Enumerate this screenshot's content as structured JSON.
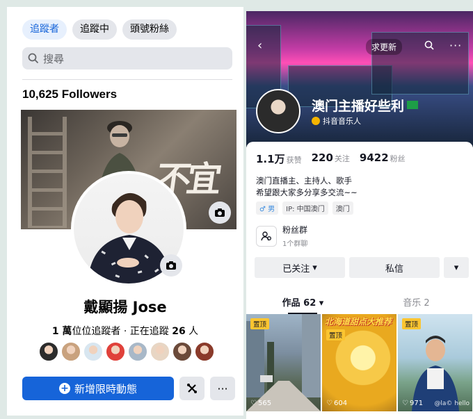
{
  "left_panel": {
    "chips": [
      "追蹤者",
      "追蹤中",
      "頭號粉絲"
    ],
    "search_placeholder": "搜尋",
    "followers_title": "10,625 Followers",
    "cover_text": "不宜遲",
    "profile_name": "戴顯揚 Jose",
    "stats": {
      "followers_count": "1 萬",
      "followers_label": "位位追蹤者",
      "separator": " · 正在追蹤 ",
      "following_count": "26",
      "following_unit": " 人"
    },
    "friend_colors": [
      "#2c2c2c",
      "#c9a27e",
      "#d8e6f0",
      "#e0413a",
      "#a8b8c8",
      "#e8d6c4",
      "#6b4a3a",
      "#8a3a2a"
    ],
    "primary_button": "新增限時動態",
    "tool_button_icon": "tools-icon",
    "more_button": "···",
    "accent_color": "#1664d9"
  },
  "right_panel": {
    "nav": {
      "back": "‹",
      "update": "求更新",
      "search_icon": "search-icon",
      "more": "···"
    },
    "name": "澳门主播好些利",
    "tag": "抖音音乐人",
    "stats": [
      {
        "value": "1.1万",
        "label": "获赞"
      },
      {
        "value": "220",
        "label": "关注"
      },
      {
        "value": "9422",
        "label": "粉丝"
      }
    ],
    "bio": [
      "澳门直播主、主持人、歌手",
      "希望跟大家多分享多交流~~"
    ],
    "badges": [
      "♂ 男",
      "IP: 中国澳门",
      "澳门"
    ],
    "fans_group": {
      "title": "粉丝群",
      "subtitle": "1个群聊"
    },
    "actions": {
      "follow": "已关注",
      "message": "私信",
      "dropdown": "▾"
    },
    "tabs": [
      "作品 62",
      "音乐 2"
    ],
    "tiles": [
      {
        "pin": "置顶",
        "likes": "565",
        "title": ""
      },
      {
        "pin": "置顶",
        "likes": "604",
        "title": "北海道甜点大推荐"
      },
      {
        "pin": "置顶",
        "likes": "971",
        "title": "",
        "watermark": "@la©  hello"
      }
    ]
  }
}
